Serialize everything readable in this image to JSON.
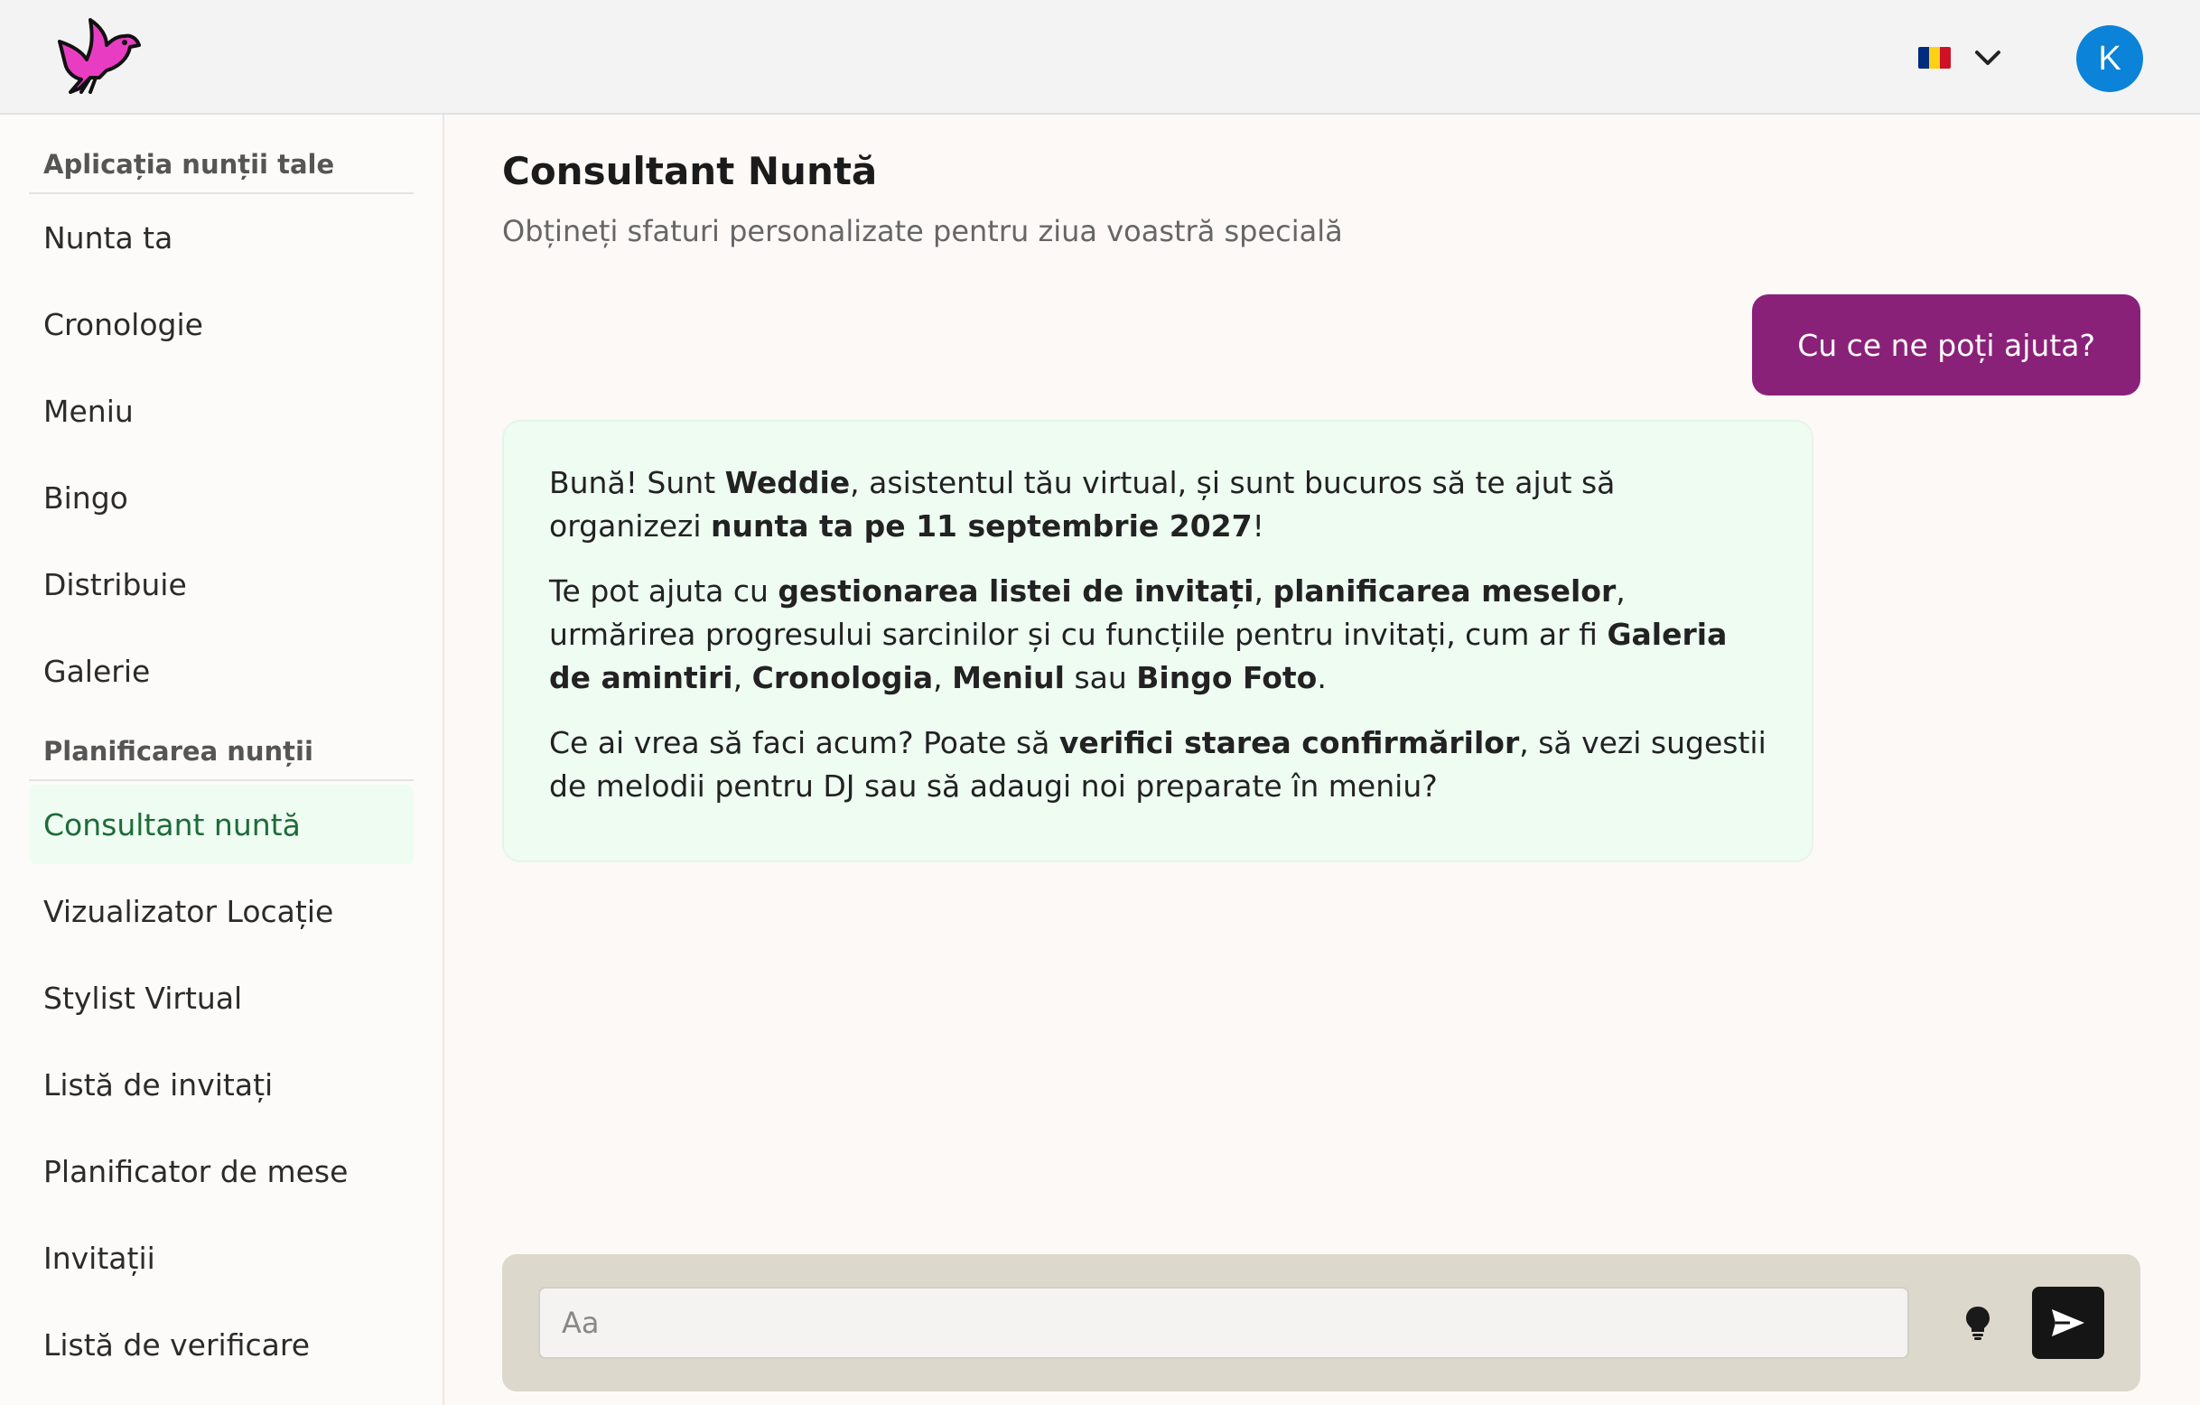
{
  "header": {
    "logo_icon": "dove-icon",
    "language": {
      "flag": "romania-flag-icon",
      "flag_colors": [
        "#002B7F",
        "#FCD116",
        "#CE1126"
      ],
      "chevron": "chevron-down-icon"
    },
    "avatar_initial": "K",
    "avatar_color": "#0a83d8"
  },
  "sidebar": {
    "group1_title": "Aplicația nunții tale",
    "group1_items": [
      {
        "label": "Nunta ta"
      },
      {
        "label": "Cronologie"
      },
      {
        "label": "Meniu"
      },
      {
        "label": "Bingo"
      },
      {
        "label": "Distribuie"
      },
      {
        "label": "Galerie"
      }
    ],
    "group2_title": "Planificarea nunții",
    "group2_items": [
      {
        "label": "Consultant nuntă",
        "active": true
      },
      {
        "label": "Vizualizator Locație"
      },
      {
        "label": "Stylist Virtual"
      },
      {
        "label": "Listă de invitați"
      },
      {
        "label": "Planificator de mese"
      },
      {
        "label": "Invitații"
      },
      {
        "label": "Listă de verificare"
      }
    ]
  },
  "main": {
    "title": "Consultant Nuntă",
    "subtitle": "Obțineți sfaturi personalizate pentru ziua voastră specială",
    "user_message": "Cu ce ne poți ajuta?",
    "user_bubble_color": "#8a2178",
    "assistant_message": {
      "p1": [
        "Bună! Sunt ",
        "Weddie",
        ", asistentul tău virtual, și sunt bucuros să te ajut să organizezi ",
        "nunta ta pe 11 septembrie 2027",
        "!"
      ],
      "p2": [
        "Te pot ajuta cu ",
        "gestionarea listei de invitați",
        ", ",
        "planificarea meselor",
        ", urmărirea progresului sarcinilor și cu funcțiile pentru invitați, cum ar fi ",
        "Galeria de amintiri",
        ", ",
        "Cronologia",
        ", ",
        "Meniul",
        " sau ",
        "Bingo Foto",
        "."
      ],
      "p3": [
        "Ce ai vrea să faci acum? Poate să ",
        "verifici starea confirmărilor",
        ", să vezi sugestii de melodii pentru DJ sau să adaugi noi preparate în meniu?"
      ]
    },
    "composer": {
      "placeholder": "Aa",
      "value": "",
      "suggest_icon": "lightbulb-icon",
      "send_icon": "send-icon"
    }
  }
}
